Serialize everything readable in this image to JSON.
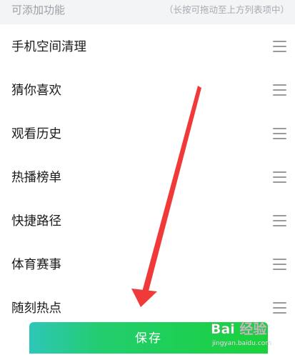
{
  "header": {
    "title": "可添加功能",
    "hint": "（长按可拖动至上方列表项中）"
  },
  "items": [
    {
      "label": "手机空间清理"
    },
    {
      "label": "猜你喜欢"
    },
    {
      "label": "观看历史"
    },
    {
      "label": "热播榜单"
    },
    {
      "label": "快捷路径"
    },
    {
      "label": "体育赛事"
    },
    {
      "label": "随刻热点"
    }
  ],
  "save_button": {
    "label": "保存"
  },
  "watermark": {
    "main": "Bai 经验",
    "sub": "jingyan.baidu.com"
  },
  "colors": {
    "save_gradient_start": "#2ec7b8",
    "save_gradient_end": "#19d23a",
    "arrow": "#f03a3a",
    "header_bg": "#f3f4f6"
  }
}
